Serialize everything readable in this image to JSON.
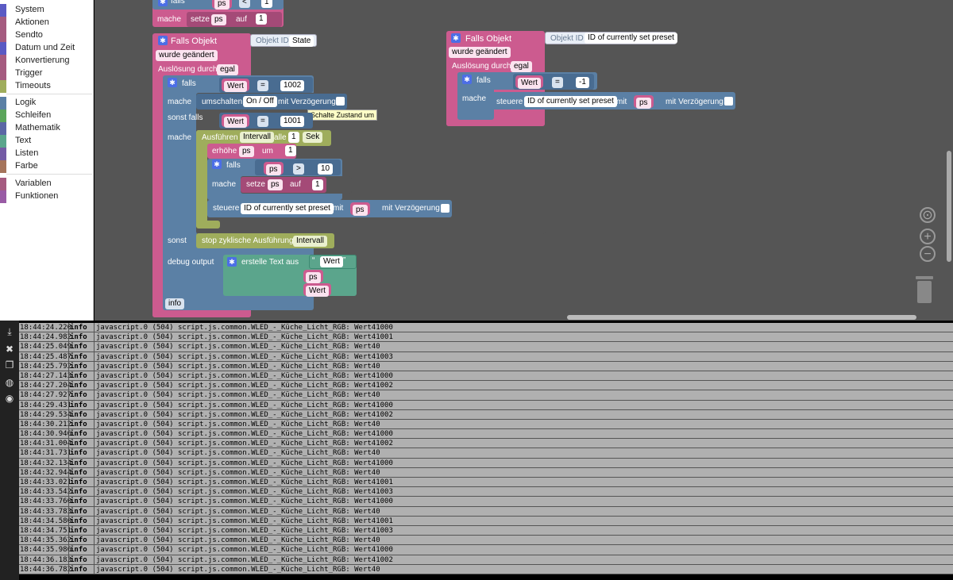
{
  "toolbox": {
    "items": [
      {
        "label": "System",
        "color": "#5a5ac4"
      },
      {
        "label": "Aktionen",
        "color": "#a55b80"
      },
      {
        "label": "Sendto",
        "color": "#a55b80"
      },
      {
        "label": "Datum und Zeit",
        "color": "#5a5ac4"
      },
      {
        "label": "Konvertierung",
        "color": "#a55b80"
      },
      {
        "label": "Trigger",
        "color": "#a55b80"
      },
      {
        "label": "Timeouts",
        "color": "#9fad5c"
      },
      {
        "label": "Logik",
        "color": "#5b80a5"
      },
      {
        "label": "Schleifen",
        "color": "#5ba55b"
      },
      {
        "label": "Mathematik",
        "color": "#5b67a5"
      },
      {
        "label": "Text",
        "color": "#5ba58c"
      },
      {
        "label": "Listen",
        "color": "#745ba5"
      },
      {
        "label": "Farbe",
        "color": "#a5745b"
      },
      {
        "label": "Variablen",
        "color": "#a55b80"
      },
      {
        "label": "Funktionen",
        "color": "#995ba5"
      }
    ]
  },
  "blocks": {
    "top": {
      "falls": "falls",
      "ps": "ps",
      "lt": "<",
      "one": "1",
      "mache": "mache",
      "setze": "setze",
      "auf": "auf"
    },
    "trigger1": {
      "title": "Falls Objekt",
      "objid_label": "Objekt ID",
      "objid_value": "State",
      "changed": "wurde geändert",
      "ausloesung": "Auslösung durch",
      "egal": "egal",
      "falls": "falls",
      "wert": "Wert",
      "eq": "=",
      "v1002": "1002",
      "mache": "mache",
      "umschalten": "umschalten",
      "onoff": "On / Off",
      "mitverz": "mit Verzögerung",
      "sonstfalls": "sonst falls",
      "v1001": "1001",
      "ausfuehren": "Ausführen",
      "intervall": "Intervall",
      "alle": "alle",
      "one": "1",
      "sek": "Sek",
      "erhoehe": "erhöhe",
      "ps": "ps",
      "um": "um",
      "gt": ">",
      "ten": "10",
      "setze": "setze",
      "auf": "auf",
      "steuere": "steuere",
      "preset": "ID of currently set preset",
      "mit": "mit",
      "sonst": "sonst",
      "stop": "stop zyklische Ausführung",
      "debug": "debug output",
      "erstelle": "erstelle Text aus",
      "info": "info"
    },
    "trigger2": {
      "title": "Falls Objekt",
      "objid_label": "Objekt ID",
      "objid_value": "ID of currently set preset",
      "changed": "wurde geändert",
      "ausloesung": "Auslösung durch",
      "egal": "egal",
      "falls": "falls",
      "wert": "Wert",
      "eq": "=",
      "minus1": "-1",
      "mache": "mache",
      "steuere": "steuere",
      "preset": "ID of currently set preset",
      "mit": "mit",
      "ps": "ps",
      "mitverz": "mit Verzögerung"
    },
    "tooltip": "Schalte Zustand um"
  },
  "log": {
    "source": "javascript.0 (504) script.js.common.WLED_-_Küche_Licht_RGB:",
    "rows": [
      {
        "ts": "18:44:24.220",
        "lv": "info",
        "msg": "Wert41000"
      },
      {
        "ts": "18:44:24.982",
        "lv": "info",
        "msg": "Wert41001"
      },
      {
        "ts": "18:44:25.049",
        "lv": "info",
        "msg": "Wert40"
      },
      {
        "ts": "18:44:25.487",
        "lv": "info",
        "msg": "Wert41003"
      },
      {
        "ts": "18:44:25.792",
        "lv": "info",
        "msg": "Wert40"
      },
      {
        "ts": "18:44:27.143",
        "lv": "info",
        "msg": "Wert41000"
      },
      {
        "ts": "18:44:27.204",
        "lv": "info",
        "msg": "Wert41002"
      },
      {
        "ts": "18:44:27.927",
        "lv": "info",
        "msg": "Wert40"
      },
      {
        "ts": "18:44:29.431",
        "lv": "info",
        "msg": "Wert41000"
      },
      {
        "ts": "18:44:29.534",
        "lv": "info",
        "msg": "Wert41002"
      },
      {
        "ts": "18:44:30.212",
        "lv": "info",
        "msg": "Wert40"
      },
      {
        "ts": "18:44:30.946",
        "lv": "info",
        "msg": "Wert41000"
      },
      {
        "ts": "18:44:31.004",
        "lv": "info",
        "msg": "Wert41002"
      },
      {
        "ts": "18:44:31.731",
        "lv": "info",
        "msg": "Wert40"
      },
      {
        "ts": "18:44:32.134",
        "lv": "info",
        "msg": "Wert41000"
      },
      {
        "ts": "18:44:32.944",
        "lv": "info",
        "msg": "Wert40"
      },
      {
        "ts": "18:44:33.021",
        "lv": "info",
        "msg": "Wert41001"
      },
      {
        "ts": "18:44:33.542",
        "lv": "info",
        "msg": "Wert41003"
      },
      {
        "ts": "18:44:33.760",
        "lv": "info",
        "msg": "Wert41000"
      },
      {
        "ts": "18:44:33.783",
        "lv": "info",
        "msg": "Wert40"
      },
      {
        "ts": "18:44:34.580",
        "lv": "info",
        "msg": "Wert41001"
      },
      {
        "ts": "18:44:34.751",
        "lv": "info",
        "msg": "Wert41003"
      },
      {
        "ts": "18:44:35.362",
        "lv": "info",
        "msg": "Wert40"
      },
      {
        "ts": "18:44:35.986",
        "lv": "info",
        "msg": "Wert41000"
      },
      {
        "ts": "18:44:36.183",
        "lv": "info",
        "msg": "Wert41002"
      },
      {
        "ts": "18:44:36.782",
        "lv": "info",
        "msg": "Wert40"
      }
    ]
  },
  "log_tools": [
    {
      "icon": "scroll-down-icon",
      "glyph": "⤓"
    },
    {
      "icon": "clear-icon",
      "glyph": "✖"
    },
    {
      "icon": "copy-icon",
      "glyph": "❐"
    },
    {
      "icon": "filter-icon",
      "glyph": "◍"
    },
    {
      "icon": "hide-icon",
      "glyph": "◉"
    }
  ]
}
